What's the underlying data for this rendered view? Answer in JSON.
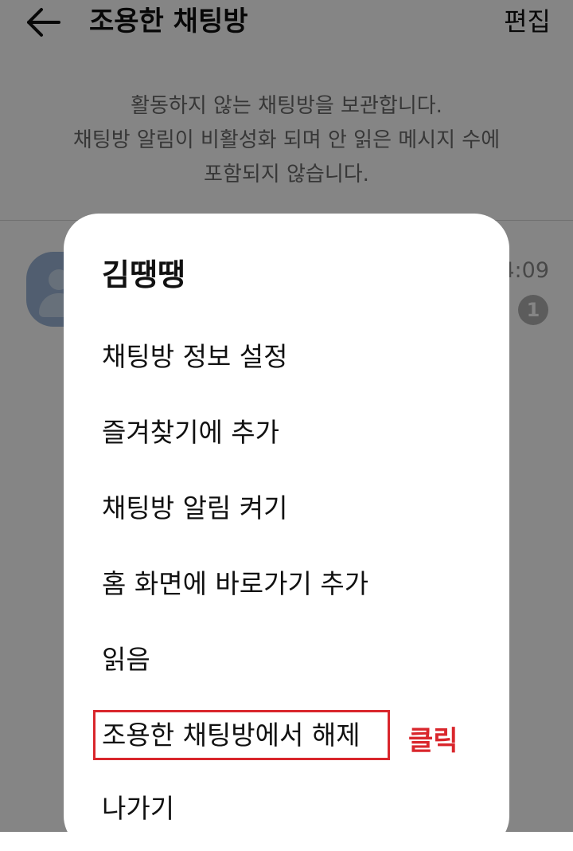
{
  "header": {
    "back_icon": "arrow-left-icon",
    "title": "조용한 채팅방",
    "edit_label": "편집"
  },
  "info": {
    "line1": "활동하지 않는 채팅방을 보관합니다.",
    "line2": "채팅방 알림이 비활성화 되며 안 읽은 메시지 수에",
    "line3": "포함되지 않습니다."
  },
  "chat": {
    "avatar_icon": "default-profile-icon",
    "time": "4:09",
    "unread_count": "1"
  },
  "sheet": {
    "title": "김땡땡",
    "items": [
      {
        "label": "채팅방 정보 설정"
      },
      {
        "label": "즐겨찾기에 추가"
      },
      {
        "label": "채팅방 알림 켜기"
      },
      {
        "label": "홈 화면에 바로가기 추가"
      },
      {
        "label": "읽음"
      },
      {
        "label": "조용한 채팅방에서 해제"
      },
      {
        "label": "나가기"
      }
    ]
  },
  "annotation": {
    "label": "클릭",
    "color": "#d9262c"
  }
}
